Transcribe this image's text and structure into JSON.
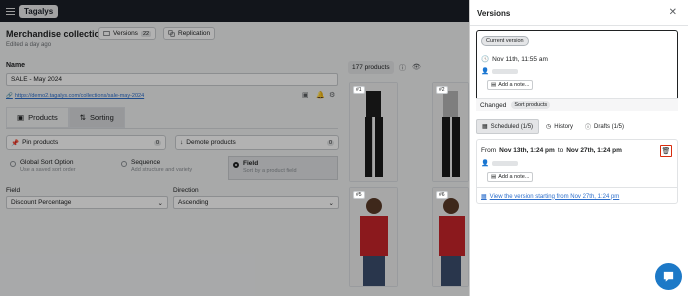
{
  "app": {
    "logo": "Tagalys"
  },
  "header": {
    "title": "Merchandise collection",
    "subtitle": "Edited a day ago",
    "versions_label": "Versions",
    "versions_count": "22",
    "replication_label": "Replication"
  },
  "left": {
    "name_label": "Name",
    "name_value": "SALE - May 2024",
    "url": "https://demo2.tagalys.com/collections/sale-may-2024",
    "tabs": [
      {
        "label": "Products"
      },
      {
        "label": "Sorting"
      }
    ],
    "pin_label": "Pin products",
    "pin_count": "0",
    "demote_label": "Demote products",
    "demote_count": "0",
    "options": [
      {
        "label": "Global Sort Option",
        "sub": "Use a saved sort order"
      },
      {
        "label": "Sequence",
        "sub": "Add structure and variety"
      },
      {
        "label": "Field",
        "sub": "Sort by a product field"
      }
    ],
    "field_label": "Field",
    "field_value": "Discount Percentage",
    "direction_label": "Direction",
    "direction_value": "Ascending"
  },
  "products": {
    "count_label": "177 products",
    "cards": [
      {
        "num": "#1"
      },
      {
        "num": "#2"
      },
      {
        "num": "#5"
      },
      {
        "num": "#6"
      }
    ]
  },
  "panel": {
    "title": "Versions",
    "current_badge": "Current version",
    "current_time": "Nov 11th, 11:55 am",
    "add_note": "Add a note...",
    "changed_label": "Changed",
    "changed_tag": "Sort products",
    "tabs": [
      {
        "label": "Scheduled (1/5)"
      },
      {
        "label": "History"
      },
      {
        "label": "Drafts (1/5)"
      }
    ],
    "sched_from_prefix": "From",
    "sched_from": "Nov 13th, 1:24 pm",
    "sched_to_word": "to",
    "sched_to": "Nov 27th, 1:24 pm",
    "sched_add_note": "Add a note...",
    "sched_link": "View the version starting from Nov 27th, 1:24 pm"
  },
  "colors": {
    "accent": "#2c6ecb",
    "danger": "#d82c0d",
    "topbar": "#1b1f27",
    "chat": "#1d79c7"
  }
}
